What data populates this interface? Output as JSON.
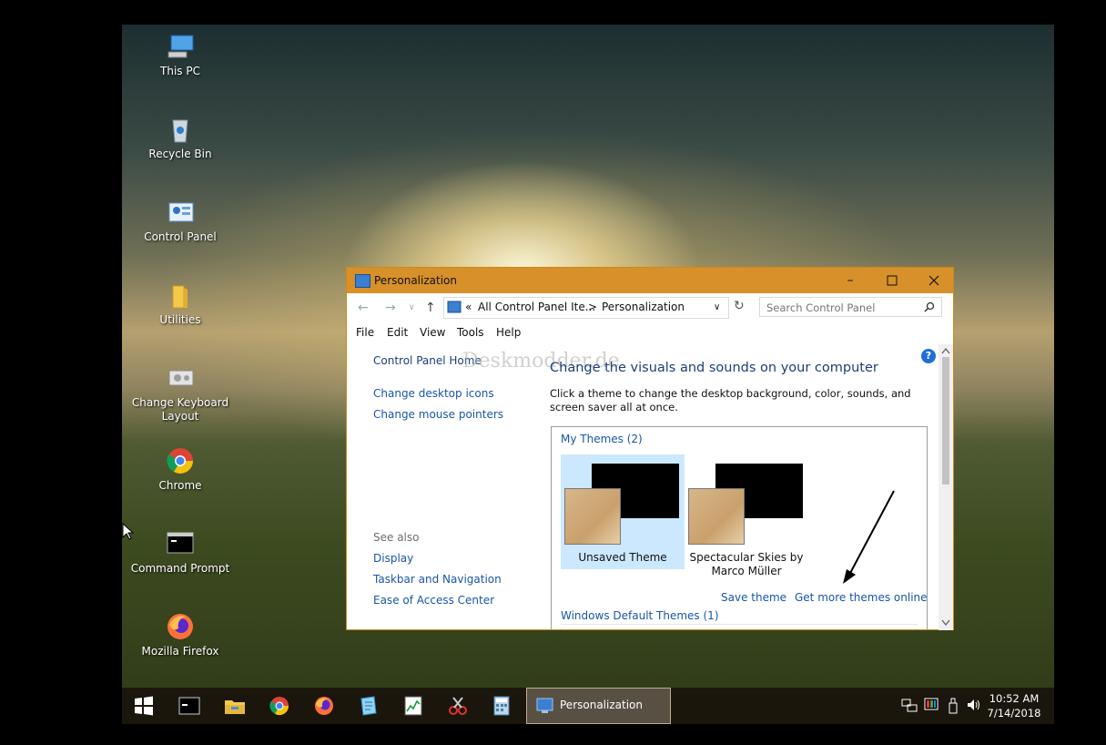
{
  "desktop": {
    "icons": [
      {
        "label": "This PC"
      },
      {
        "label": "Recycle Bin"
      },
      {
        "label": "Control Panel"
      },
      {
        "label": "Utilities"
      },
      {
        "label": "Change Keyboard Layout"
      },
      {
        "label": "Chrome"
      },
      {
        "label": "Command Prompt"
      },
      {
        "label": "Mozilla Firefox"
      }
    ]
  },
  "window": {
    "title": "Personalization",
    "breadcrumb": {
      "prefix": "«",
      "part1": "All Control Panel Ite...",
      "separator": ">",
      "part2": "Personalization"
    },
    "search_placeholder": "Search Control Panel",
    "menu": [
      "File",
      "Edit",
      "View",
      "Tools",
      "Help"
    ],
    "sidebar": {
      "home": "Control Panel Home",
      "links": [
        "Change desktop icons",
        "Change mouse pointers"
      ],
      "see_also_heading": "See also",
      "see_also": [
        "Display",
        "Taskbar and Navigation",
        "Ease of Access Center"
      ]
    },
    "watermark": "Deskmodder.de",
    "heading": "Change the visuals and sounds on your computer",
    "description": "Click a theme to change the desktop background, color, sounds, and screen saver all at once.",
    "my_themes_heading": "My Themes (2)",
    "themes": [
      {
        "name": "Unsaved Theme",
        "selected": true
      },
      {
        "name": "Spectacular Skies by Marco Müller",
        "selected": false
      }
    ],
    "save_theme": "Save theme",
    "get_more": "Get more themes online",
    "default_heading": "Windows Default Themes (1)",
    "help": "?"
  },
  "taskbar": {
    "active_label": "Personalization",
    "time": "10:52 AM",
    "date": "7/14/2018"
  },
  "colors": {
    "title_bar": "#d8902a",
    "link": "#1a55a8",
    "selection": "#cce8ff"
  }
}
